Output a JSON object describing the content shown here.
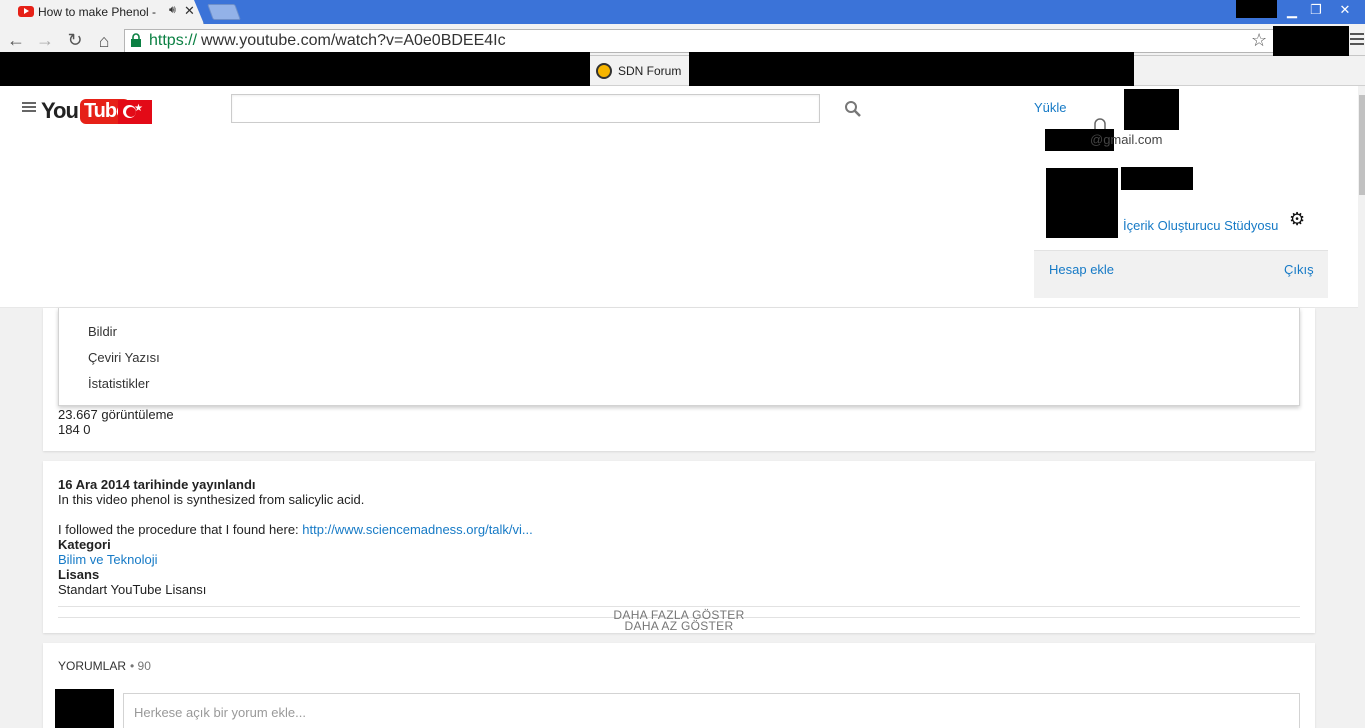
{
  "browser": {
    "tab_title": "How to make Phenol -",
    "audio_icon": "speaker-icon",
    "url_scheme": "https://",
    "url_rest": "www.youtube.com/watch?v=A0e0BDEE4Ic",
    "bookmark_label": "SDN Forum"
  },
  "header": {
    "logo_you": "You",
    "logo_tube": "Tube",
    "upload_label": "Yükle",
    "email_suffix": "@gmail.com",
    "studio_label": "İçerik Oluşturucu Stüdyosu",
    "add_account_label": "Hesap ekle",
    "signout_label": "Çıkış"
  },
  "more_menu": {
    "items": [
      "Bildir",
      "Çeviri Yazısı",
      "İstatistikler"
    ]
  },
  "stats": {
    "views": "23.667 görüntüleme",
    "likes": "184 0"
  },
  "description": {
    "published": "16 Ara 2014 tarihinde yayınlandı",
    "line1": "In this video phenol is synthesized from salicylic acid.",
    "line2_prefix": "I followed the procedure that I found here: ",
    "line2_link": "http://www.sciencemadness.org/talk/vi...",
    "category_label": "Kategori",
    "category_value": "Bilim ve Teknoloji",
    "license_label": "Lisans",
    "license_value": "Standart YouTube Lisansı",
    "show_more": "DAHA FAZLA GÖSTER",
    "show_less": "DAHA AZ GÖSTER"
  },
  "comments": {
    "title": "YORUMLAR",
    "count": "• 90",
    "placeholder": "Herkese açık bir yorum ekle..."
  },
  "colors": {
    "link": "#167ac6",
    "youtube_red": "#e62117",
    "chrome_frame": "#3b73d8",
    "secure_green": "#0b8043"
  }
}
